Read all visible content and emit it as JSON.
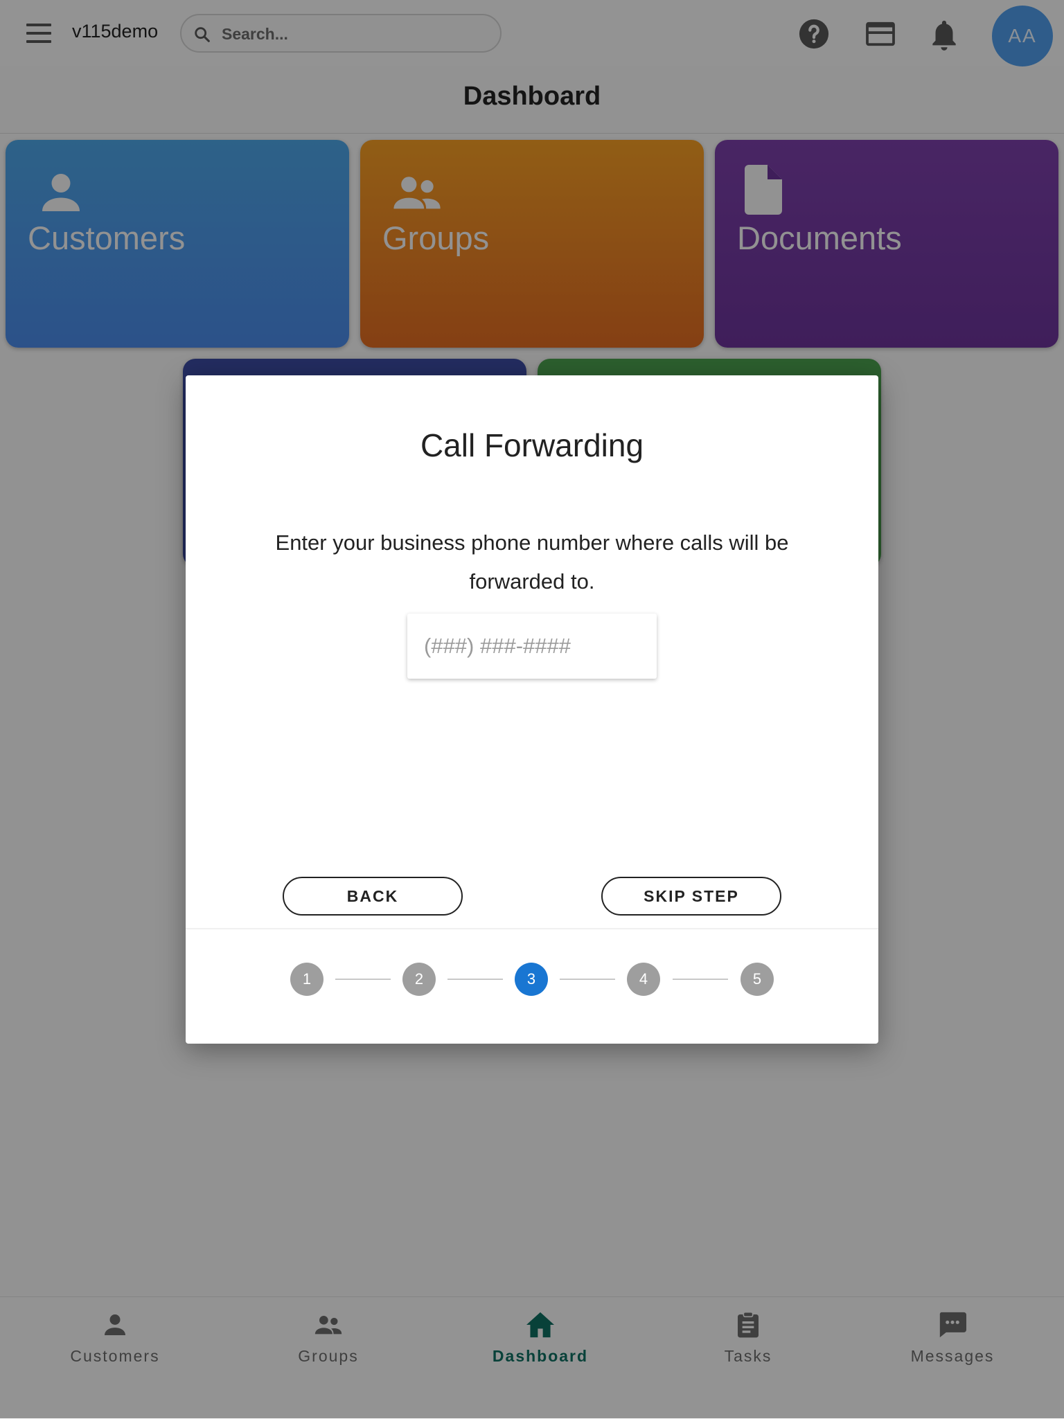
{
  "header": {
    "app_name": "v115demo",
    "search_placeholder": "Search...",
    "avatar_initials": "AA",
    "icons": [
      "menu-icon",
      "help-icon",
      "credit-card-icon",
      "notifications-icon"
    ]
  },
  "page": {
    "title": "Dashboard"
  },
  "tiles": [
    {
      "label": "Customers",
      "icon": "person-icon",
      "color": "#4a96e4"
    },
    {
      "label": "Groups",
      "icon": "people-icon",
      "color": "#eb8623"
    },
    {
      "label": "Documents",
      "icon": "document-icon",
      "color": "#733a9f"
    },
    {
      "label": "",
      "color": "#3b4aa1"
    },
    {
      "label": "",
      "color": "#4a9e4e"
    }
  ],
  "modal": {
    "title": "Call Forwarding",
    "description": "Enter your business phone number where calls will be forwarded to.",
    "phone_input": {
      "value": "",
      "placeholder": "(###) ###-####"
    },
    "back_label": "BACK",
    "skip_label": "SKIP STEP",
    "steps": [
      "1",
      "2",
      "3",
      "4",
      "5"
    ],
    "active_step": "3",
    "accent_color": "#1976d2"
  },
  "bottom_nav": {
    "items": [
      {
        "label": "Customers",
        "icon": "person-icon"
      },
      {
        "label": "Groups",
        "icon": "people-icon"
      },
      {
        "label": "Dashboard",
        "icon": "home-icon"
      },
      {
        "label": "Tasks",
        "icon": "clipboard-icon"
      },
      {
        "label": "Messages",
        "icon": "chat-icon"
      }
    ],
    "active": "Dashboard",
    "active_color": "#0e6d60"
  }
}
